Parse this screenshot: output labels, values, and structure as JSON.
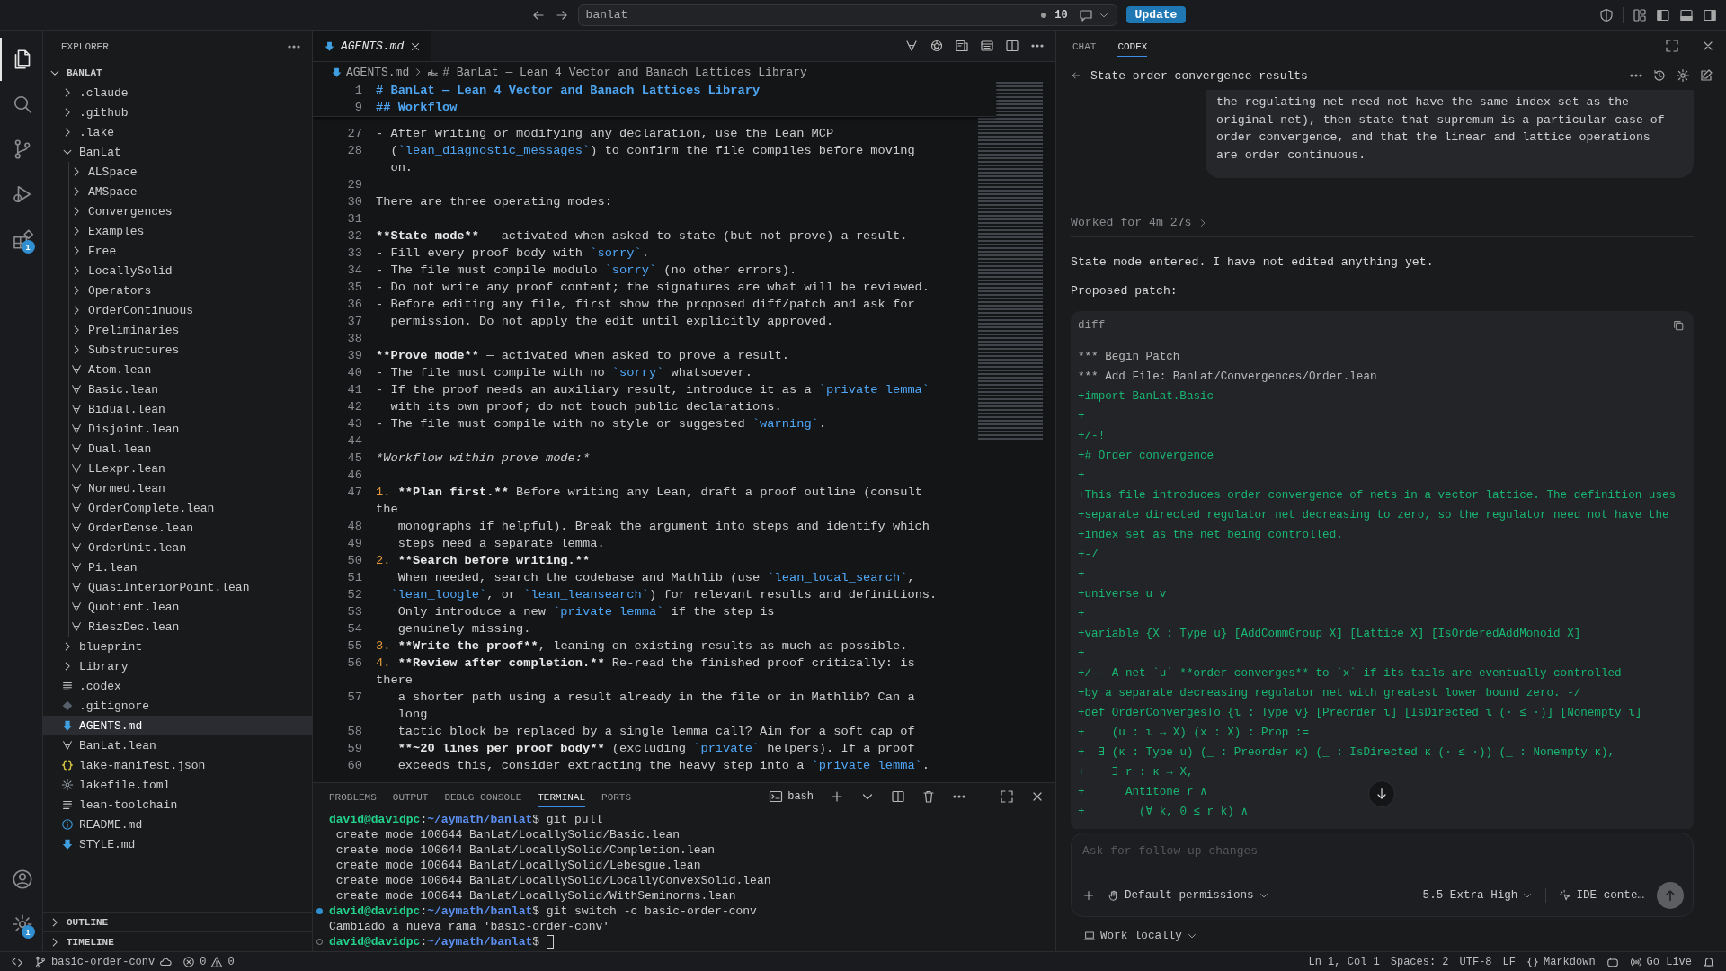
{
  "title_bar": {
    "workspace": "banlat",
    "count": "10",
    "update_button": "Update"
  },
  "activity_bar": {
    "items": [
      {
        "kind": "files",
        "selected": true
      },
      {
        "kind": "search",
        "selected": false
      },
      {
        "kind": "source-control",
        "selected": false
      },
      {
        "kind": "run-debug",
        "selected": false
      },
      {
        "kind": "extensions",
        "selected": false,
        "badge": "1"
      }
    ],
    "bottom": [
      {
        "kind": "account"
      },
      {
        "kind": "settings",
        "badge": "1"
      }
    ]
  },
  "explorer": {
    "title": "EXPLORER",
    "root": {
      "name": "BANLAT",
      "expanded": true,
      "children": [
        {
          "name": ".claude",
          "kind": "folder",
          "expanded": false,
          "selected": false
        },
        {
          "name": ".github",
          "kind": "folder",
          "expanded": false,
          "selected": false
        },
        {
          "name": ".lake",
          "kind": "folder",
          "expanded": false,
          "selected": false
        },
        {
          "name": "BanLat",
          "kind": "folder",
          "expanded": true,
          "selected": false,
          "children": [
            {
              "name": "ALSpace",
              "kind": "folder",
              "expanded": false,
              "selected": false
            },
            {
              "name": "AMSpace",
              "kind": "folder",
              "expanded": false,
              "selected": false
            },
            {
              "name": "Convergences",
              "kind": "folder",
              "expanded": false,
              "selected": false
            },
            {
              "name": "Examples",
              "kind": "folder",
              "expanded": false,
              "selected": false
            },
            {
              "name": "Free",
              "kind": "folder",
              "expanded": false,
              "selected": false
            },
            {
              "name": "LocallySolid",
              "kind": "folder",
              "expanded": false,
              "selected": false
            },
            {
              "name": "Operators",
              "kind": "folder",
              "expanded": false,
              "selected": false
            },
            {
              "name": "OrderContinuous",
              "kind": "folder",
              "expanded": false,
              "selected": false
            },
            {
              "name": "Preliminaries",
              "kind": "folder",
              "expanded": false,
              "selected": false
            },
            {
              "name": "Substructures",
              "kind": "folder",
              "expanded": false,
              "selected": false
            },
            {
              "name": "Atom.lean",
              "kind": "lean",
              "selected": false
            },
            {
              "name": "Basic.lean",
              "kind": "lean",
              "selected": false
            },
            {
              "name": "Bidual.lean",
              "kind": "lean",
              "selected": false
            },
            {
              "name": "Disjoint.lean",
              "kind": "lean",
              "selected": false
            },
            {
              "name": "Dual.lean",
              "kind": "lean",
              "selected": false
            },
            {
              "name": "LLexpr.lean",
              "kind": "lean",
              "selected": false
            },
            {
              "name": "Normed.lean",
              "kind": "lean",
              "selected": false
            },
            {
              "name": "OrderComplete.lean",
              "kind": "lean",
              "selected": false
            },
            {
              "name": "OrderDense.lean",
              "kind": "lean",
              "selected": false
            },
            {
              "name": "OrderUnit.lean",
              "kind": "lean",
              "selected": false
            },
            {
              "name": "Pi.lean",
              "kind": "lean",
              "selected": false
            },
            {
              "name": "QuasiInteriorPoint.lean",
              "kind": "lean",
              "selected": false
            },
            {
              "name": "Quotient.lean",
              "kind": "lean",
              "selected": false
            },
            {
              "name": "RieszDec.lean",
              "kind": "lean",
              "selected": false
            }
          ]
        },
        {
          "name": "blueprint",
          "kind": "folder",
          "expanded": false,
          "selected": false
        },
        {
          "name": "Library",
          "kind": "folder",
          "expanded": false,
          "selected": false
        },
        {
          "name": ".codex",
          "kind": "text",
          "selected": false
        },
        {
          "name": ".gitignore",
          "kind": "gitignore",
          "selected": false
        },
        {
          "name": "AGENTS.md",
          "kind": "markdown",
          "selected": true
        },
        {
          "name": "BanLat.lean",
          "kind": "lean",
          "selected": false
        },
        {
          "name": "lake-manifest.json",
          "kind": "json",
          "selected": false
        },
        {
          "name": "lakefile.toml",
          "kind": "toml",
          "selected": false
        },
        {
          "name": "lean-toolchain",
          "kind": "text",
          "selected": false
        },
        {
          "name": "README.md",
          "kind": "info",
          "selected": false
        },
        {
          "name": "STYLE.md",
          "kind": "markdown",
          "selected": false
        }
      ]
    },
    "sections": [
      {
        "title": "OUTLINE",
        "expanded": false
      },
      {
        "title": "TIMELINE",
        "expanded": false
      }
    ]
  },
  "editor": {
    "tabs": [
      {
        "label": "AGENTS.md",
        "selected": true,
        "preview": true
      }
    ],
    "breadcrumb": [
      "AGENTS.md",
      "# BanLat — Lean 4 Vector and Banach Lattices Library"
    ],
    "sticky": [
      {
        "number": "1",
        "spans": [
          {
            "kind": "heading",
            "text": "# BanLat — Lean 4 Vector and Banach Lattices Library"
          }
        ]
      },
      {
        "number": "9",
        "spans": [
          {
            "kind": "heading",
            "text": "## Workflow"
          }
        ]
      }
    ],
    "rows": [
      {
        "number": "27",
        "spans": [
          {
            "kind": "text",
            "text": "- After writing or modifying any declaration, use the Lean MCP"
          }
        ]
      },
      {
        "number": "28",
        "spans": [
          {
            "kind": "text",
            "text": "  ("
          },
          {
            "kind": "code",
            "text": "`lean_diagnostic_messages`"
          },
          {
            "kind": "text",
            "text": ") to confirm the file compiles before moving"
          }
        ]
      },
      {
        "spans": [
          {
            "kind": "text",
            "text": "  on."
          }
        ]
      },
      {
        "number": "29"
      },
      {
        "number": "30",
        "spans": [
          {
            "kind": "text",
            "text": "There are three operating modes:"
          }
        ]
      },
      {
        "number": "31"
      },
      {
        "number": "32",
        "spans": [
          {
            "kind": "bold",
            "text": "**State mode**"
          },
          {
            "kind": "text",
            "text": " — activated when asked to state (but not prove) a result."
          }
        ]
      },
      {
        "number": "33",
        "spans": [
          {
            "kind": "text",
            "text": "- Fill every proof body with "
          },
          {
            "kind": "code",
            "text": "`sorry`"
          },
          {
            "kind": "text",
            "text": "."
          }
        ]
      },
      {
        "number": "34",
        "spans": [
          {
            "kind": "text",
            "text": "- The file must compile modulo "
          },
          {
            "kind": "code",
            "text": "`sorry`"
          },
          {
            "kind": "text",
            "text": " (no other errors)."
          }
        ]
      },
      {
        "number": "35",
        "spans": [
          {
            "kind": "text",
            "text": "- Do not write any proof content; the signatures are what will be reviewed."
          }
        ]
      },
      {
        "number": "36",
        "spans": [
          {
            "kind": "text",
            "text": "- Before editing any file, first show the proposed diff/patch and ask for"
          }
        ]
      },
      {
        "number": "37",
        "spans": [
          {
            "kind": "text",
            "text": "  permission. Do not apply the edit until explicitly approved."
          }
        ]
      },
      {
        "number": "38"
      },
      {
        "number": "39",
        "spans": [
          {
            "kind": "bold",
            "text": "**Prove mode**"
          },
          {
            "kind": "text",
            "text": " — activated when asked to prove a result."
          }
        ]
      },
      {
        "number": "40",
        "spans": [
          {
            "kind": "text",
            "text": "- The file must compile with no "
          },
          {
            "kind": "code",
            "text": "`sorry`"
          },
          {
            "kind": "text",
            "text": " whatsoever."
          }
        ]
      },
      {
        "number": "41",
        "spans": [
          {
            "kind": "text",
            "text": "- If the proof needs an auxiliary result, introduce it as a "
          },
          {
            "kind": "code",
            "text": "`private lemma`"
          }
        ]
      },
      {
        "number": "42",
        "spans": [
          {
            "kind": "text",
            "text": "  with its own proof; do not touch public declarations."
          }
        ]
      },
      {
        "number": "43",
        "spans": [
          {
            "kind": "text",
            "text": "- The file must compile with no style or suggested "
          },
          {
            "kind": "code",
            "text": "`warning`"
          },
          {
            "kind": "text",
            "text": "."
          }
        ]
      },
      {
        "number": "44"
      },
      {
        "number": "45",
        "spans": [
          {
            "kind": "italic",
            "text": "*Workflow within prove mode:*"
          }
        ]
      },
      {
        "number": "46"
      },
      {
        "number": "47",
        "spans": [
          {
            "kind": "number",
            "text": "1. "
          },
          {
            "kind": "bold",
            "text": "**Plan first.**"
          },
          {
            "kind": "text",
            "text": " Before writing any Lean, draft a proof outline (consult"
          }
        ]
      },
      {
        "spans": [
          {
            "kind": "text",
            "text": "the"
          }
        ]
      },
      {
        "number": "48",
        "spans": [
          {
            "kind": "text",
            "text": "   monographs if helpful). Break the argument into steps and identify which"
          }
        ]
      },
      {
        "number": "49",
        "spans": [
          {
            "kind": "text",
            "text": "   steps need a separate lemma."
          }
        ]
      },
      {
        "number": "50",
        "spans": [
          {
            "kind": "number",
            "text": "2. "
          },
          {
            "kind": "bold",
            "text": "**Search before writing.**"
          }
        ]
      },
      {
        "number": "51",
        "spans": [
          {
            "kind": "text",
            "text": "   When needed, search the codebase and Mathlib (use "
          },
          {
            "kind": "code",
            "text": "`lean_local_search`"
          },
          {
            "kind": "text",
            "text": ","
          }
        ]
      },
      {
        "number": "52",
        "spans": [
          {
            "kind": "code",
            "text": "  `lean_loogle`"
          },
          {
            "kind": "text",
            "text": ", or "
          },
          {
            "kind": "code",
            "text": "`lean_leansearch`"
          },
          {
            "kind": "text",
            "text": ") for relevant results and definitions."
          }
        ]
      },
      {
        "number": "53",
        "spans": [
          {
            "kind": "text",
            "text": "   Only introduce a new "
          },
          {
            "kind": "code",
            "text": "`private lemma`"
          },
          {
            "kind": "text",
            "text": " if the step is"
          }
        ]
      },
      {
        "number": "54",
        "spans": [
          {
            "kind": "text",
            "text": "   genuinely missing."
          }
        ]
      },
      {
        "number": "55",
        "spans": [
          {
            "kind": "number",
            "text": "3. "
          },
          {
            "kind": "bold",
            "text": "**Write the proof**"
          },
          {
            "kind": "text",
            "text": ", leaning on existing results as much as possible."
          }
        ]
      },
      {
        "number": "56",
        "spans": [
          {
            "kind": "number",
            "text": "4. "
          },
          {
            "kind": "bold",
            "text": "**Review after completion.**"
          },
          {
            "kind": "text",
            "text": " Re-read the finished proof critically: is"
          }
        ]
      },
      {
        "spans": [
          {
            "kind": "text",
            "text": "there"
          }
        ]
      },
      {
        "number": "57",
        "spans": [
          {
            "kind": "text",
            "text": "   a shorter path using a result already in the file or in Mathlib? Can a"
          }
        ]
      },
      {
        "spans": [
          {
            "kind": "text",
            "text": "   long"
          }
        ]
      },
      {
        "number": "58",
        "spans": [
          {
            "kind": "text",
            "text": "   tactic block be replaced by a single lemma call? Aim for a soft cap of"
          }
        ]
      },
      {
        "number": "59",
        "spans": [
          {
            "kind": "bold",
            "text": "   **~20 lines per proof body**"
          },
          {
            "kind": "text",
            "text": " (excluding "
          },
          {
            "kind": "code",
            "text": "`private`"
          },
          {
            "kind": "text",
            "text": " helpers). If a proof"
          }
        ]
      },
      {
        "number": "60",
        "spans": [
          {
            "kind": "text",
            "text": "   exceeds this, consider extracting the heavy step into a "
          },
          {
            "kind": "code",
            "text": "`private lemma`"
          },
          {
            "kind": "text",
            "text": "."
          }
        ]
      }
    ]
  },
  "panel": {
    "tabs": [
      {
        "label": "PROBLEMS",
        "selected": false
      },
      {
        "label": "OUTPUT",
        "selected": false
      },
      {
        "label": "DEBUG CONSOLE",
        "selected": false
      },
      {
        "label": "TERMINAL",
        "selected": true
      },
      {
        "label": "PORTS",
        "selected": false
      }
    ],
    "shell": "bash",
    "lines": [
      {
        "kind": "prompt",
        "spans": [
          {
            "kind": "user",
            "text": "david@davidpc"
          },
          {
            "kind": "text",
            "text": ":"
          },
          {
            "kind": "path",
            "text": "~/aymath/banlat"
          },
          {
            "kind": "text",
            "text": "$ git pull"
          }
        ]
      },
      {
        "kind": "output",
        "spans": [
          {
            "kind": "text",
            "text": " create mode 100644 BanLat/LocallySolid/Basic.lean"
          }
        ]
      },
      {
        "kind": "output",
        "spans": [
          {
            "kind": "text",
            "text": " create mode 100644 BanLat/LocallySolid/Completion.lean"
          }
        ]
      },
      {
        "kind": "output",
        "spans": [
          {
            "kind": "text",
            "text": " create mode 100644 BanLat/LocallySolid/Lebesgue.lean"
          }
        ]
      },
      {
        "kind": "output",
        "spans": [
          {
            "kind": "text",
            "text": " create mode 100644 BanLat/LocallySolid/LocallyConvexSolid.lean"
          }
        ]
      },
      {
        "kind": "output",
        "spans": [
          {
            "kind": "text",
            "text": " create mode 100644 BanLat/LocallySolid/WithSeminorms.lean"
          }
        ]
      },
      {
        "kind": "success",
        "spans": [
          {
            "kind": "user",
            "text": "david@davidpc"
          },
          {
            "kind": "text",
            "text": ":"
          },
          {
            "kind": "path",
            "text": "~/aymath/banlat"
          },
          {
            "kind": "text",
            "text": "$ git switch -c basic-order-conv"
          }
        ]
      },
      {
        "kind": "output",
        "spans": [
          {
            "kind": "text",
            "text": "Cambiado a nueva rama 'basic-order-conv'"
          }
        ]
      },
      {
        "kind": "current",
        "cursor": true,
        "spans": [
          {
            "kind": "user",
            "text": "david@davidpc"
          },
          {
            "kind": "text",
            "text": ":"
          },
          {
            "kind": "path",
            "text": "~/aymath/banlat"
          },
          {
            "kind": "text",
            "text": "$ "
          }
        ]
      }
    ]
  },
  "codex": {
    "tabs": [
      {
        "label": "CHAT",
        "selected": false
      },
      {
        "label": "CODEX",
        "selected": true
      }
    ],
    "thread_title": "State order convergence results",
    "user_message": [
      "the regulating net need not have the same index set as the",
      "original net), then state that supremum is a particular case of",
      "order convergence, and that the linear and lattice operations",
      "are order continuous."
    ],
    "worked": "Worked for 4m 27s",
    "messages": [
      "State mode entered. I have not edited anything yet.",
      "Proposed patch:"
    ],
    "code_block": {
      "language": "diff",
      "lines": [
        {
          "kind": "meta",
          "text": "*** Begin Patch"
        },
        {
          "kind": "meta",
          "text": "*** Add File: BanLat/Convergences/Order.lean"
        },
        {
          "kind": "added",
          "text": "+import BanLat.Basic"
        },
        {
          "kind": "added",
          "text": "+"
        },
        {
          "kind": "added",
          "text": "+/-!"
        },
        {
          "kind": "added",
          "text": "+# Order convergence"
        },
        {
          "kind": "added",
          "text": "+"
        },
        {
          "kind": "added",
          "text": "+This file introduces order convergence of nets in a vector lattice. The definition uses"
        },
        {
          "kind": "added",
          "text": "+separate directed regulator net decreasing to zero, so the regulator need not have the"
        },
        {
          "kind": "added",
          "text": "+index set as the net being controlled."
        },
        {
          "kind": "added",
          "text": "+-/"
        },
        {
          "kind": "added",
          "text": "+"
        },
        {
          "kind": "added",
          "text": "+universe u v"
        },
        {
          "kind": "added",
          "text": "+"
        },
        {
          "kind": "added",
          "text": "+variable {X : Type u} [AddCommGroup X] [Lattice X] [IsOrderedAddMonoid X]"
        },
        {
          "kind": "added",
          "text": "+"
        },
        {
          "kind": "added",
          "text": "+/-- A net `u` **order converges** to `x` if its tails are eventually controlled"
        },
        {
          "kind": "added",
          "text": "+by a separate decreasing regulator net with greatest lower bound zero. -/"
        },
        {
          "kind": "added",
          "text": "+def OrderConvergesTo {ι : Type v} [Preorder ι] [IsDirected ι (· ≤ ·)] [Nonempty ι]"
        },
        {
          "kind": "added",
          "text": "+    (u : ι → X) (x : X) : Prop :="
        },
        {
          "kind": "added",
          "text": "+  ∃ (κ : Type u) (_ : Preorder κ) (_ : IsDirected κ (· ≤ ·)) (_ : Nonempty κ),"
        },
        {
          "kind": "added",
          "text": "+    ∃ r : κ → X,"
        },
        {
          "kind": "added",
          "text": "+      Antitone r ∧"
        },
        {
          "kind": "added",
          "text": "+        (∀ k, 0 ≤ r k) ∧"
        }
      ]
    },
    "input": {
      "placeholder": "Ask for follow-up changes"
    },
    "permissions": "Default permissions",
    "model": "5.5 Extra High",
    "context": "IDE conte…",
    "work_mode": "Work locally"
  },
  "status_bar": {
    "branch": "basic-order-conv",
    "errors": "0",
    "warnings": "0",
    "position": "Ln 1, Col 1",
    "indent": "Spaces: 2",
    "encoding": "UTF-8",
    "eol": "LF",
    "language": "Markdown",
    "go_live": "Go Live"
  }
}
